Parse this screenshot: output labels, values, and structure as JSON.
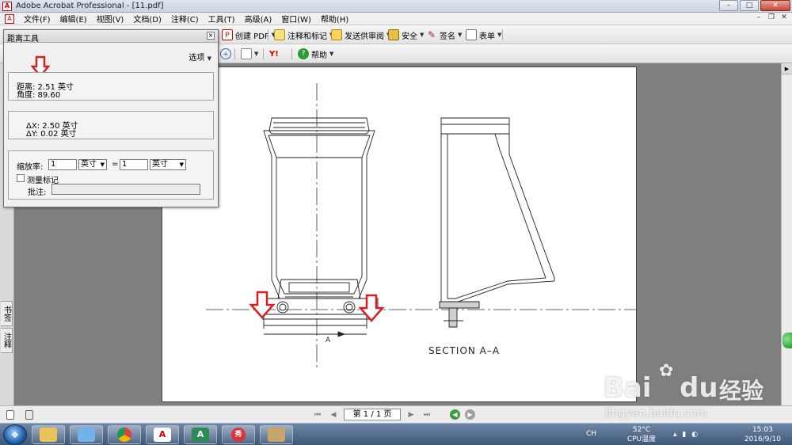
{
  "window": {
    "title": "Adobe Acrobat Professional - [11.pdf]",
    "controls": [
      "–",
      "□",
      "✕"
    ]
  },
  "menubar": {
    "items": [
      "文件(F)",
      "编辑(E)",
      "视图(V)",
      "文档(D)",
      "注释(C)",
      "工具(T)",
      "高级(A)",
      "窗口(W)",
      "帮助(H)"
    ]
  },
  "toolbar": {
    "create_pdf": "创建 PDF",
    "comment_markup": "注释和标记",
    "send_review": "发送供审阅",
    "security": "安全",
    "sign": "签名",
    "forms": "表单",
    "help": "帮助"
  },
  "distance_tool": {
    "title": "距离工具",
    "options": "选项",
    "distance": "距离: 2.51 英寸",
    "angle": "角度: 89.60",
    "dx": "ΔX: 2.50 英寸",
    "dy": "ΔY: 0.02 英寸",
    "scale_label": "缩放率:",
    "scale_left_value": "1",
    "scale_left_unit": "英寸",
    "equals": "=",
    "scale_right_value": "1",
    "scale_right_unit": "英寸",
    "measure_markup": "测量标记",
    "note_label": "批注:"
  },
  "left_tabs": [
    "书签",
    "注释"
  ],
  "drawing": {
    "dimension_letter": "A",
    "section_label": "SECTION A–A",
    "accent_color": "#d41f26"
  },
  "status": {
    "page_indicator": "第 1 / 1 页"
  },
  "taskbar": {
    "input_lang": "CH",
    "cpu_temp": "52°C",
    "cpu_label": "CPU温度",
    "time": "15:03",
    "date": "2016/9/10"
  },
  "watermark": {
    "brand": "Bai",
    "brand2": "du",
    "cn": "经验",
    "url": "jingyan.baidu.com"
  }
}
